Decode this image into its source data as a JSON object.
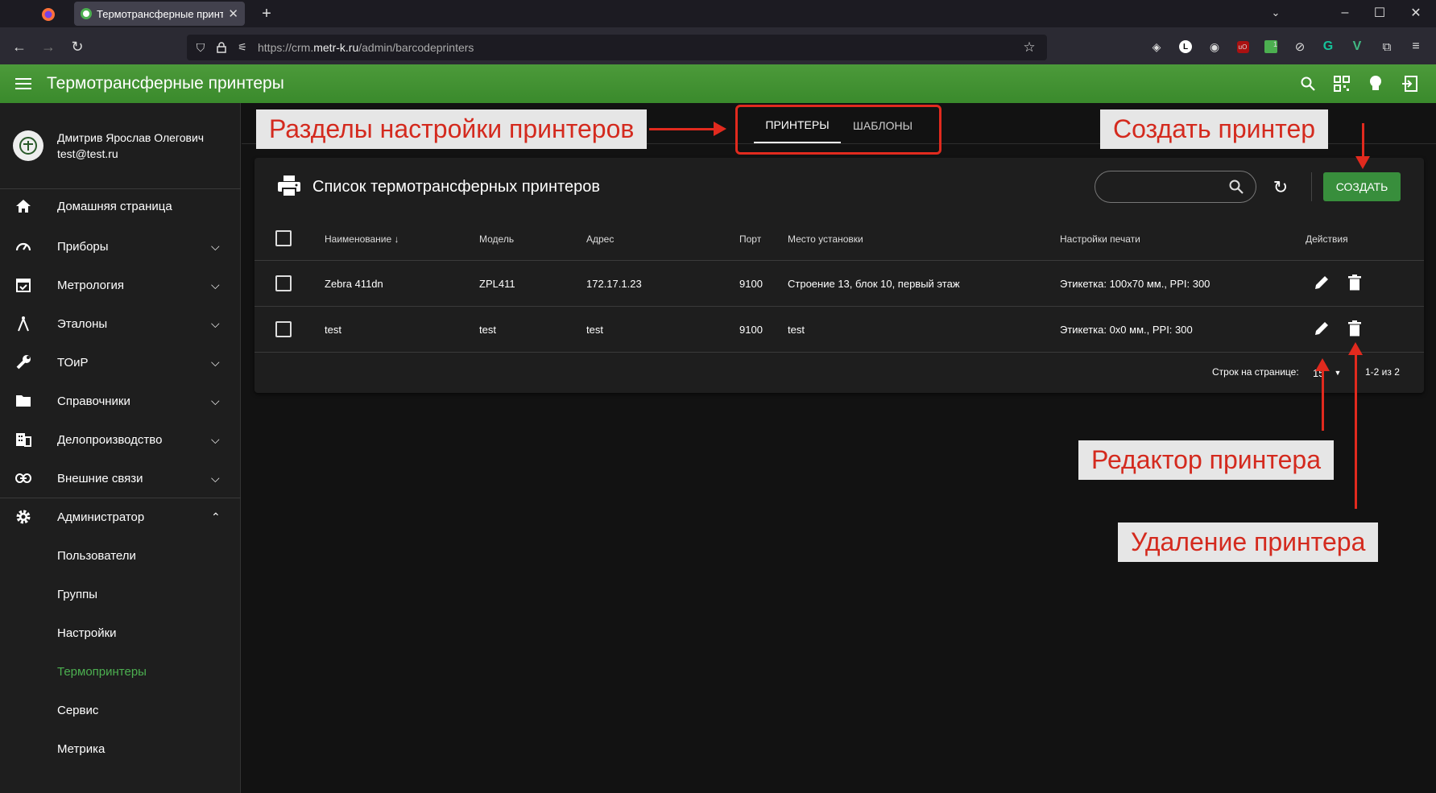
{
  "browser": {
    "tab_title": "Термотрансферные принтеры",
    "url_prefix": "https://crm.",
    "url_domain": "metr-k.ru",
    "url_path": "/admin/barcodeprinters"
  },
  "header": {
    "title": "Термотрансферные принтеры"
  },
  "user": {
    "name": "Дмитрив Ярослав Олегович",
    "email": "test@test.ru"
  },
  "sidebar": {
    "items": [
      {
        "label": "Домашняя страница",
        "icon": "home-icon"
      },
      {
        "label": "Приборы",
        "icon": "speedometer-icon"
      },
      {
        "label": "Метрология",
        "icon": "checkbox-calendar-icon"
      },
      {
        "label": "Эталоны",
        "icon": "compass-icon"
      },
      {
        "label": "ТОиР",
        "icon": "wrench-icon"
      },
      {
        "label": "Справочники",
        "icon": "folder-icon"
      },
      {
        "label": "Делопроизводство",
        "icon": "building-icon"
      },
      {
        "label": "Внешние связи",
        "icon": "link-icon"
      },
      {
        "label": "Администратор",
        "icon": "gear-icon"
      }
    ],
    "admin_sub": [
      {
        "label": "Пользователи"
      },
      {
        "label": "Группы"
      },
      {
        "label": "Настройки"
      },
      {
        "label": "Термопринтеры"
      },
      {
        "label": "Сервис"
      },
      {
        "label": "Метрика"
      }
    ]
  },
  "tabs": {
    "printers": "ПРИНТЕРЫ",
    "templates": "ШАБЛОНЫ"
  },
  "card": {
    "title": "Список термотрансферных принтеров",
    "create_label": "СОЗДАТЬ",
    "search_placeholder": ""
  },
  "table": {
    "headers": [
      "Наименование",
      "Модель",
      "Адрес",
      "Порт",
      "Место установки",
      "Настройки печати",
      "Действия"
    ],
    "rows": [
      [
        "Zebra 411dn",
        "ZPL411",
        "172.17.1.23",
        "9100",
        "Строение 13, блок 10, первый этаж",
        "Этикетка: 100х70 мм., PPI: 300"
      ],
      [
        "test",
        "test",
        "test",
        "9100",
        "test",
        "Этикетка: 0х0 мм., PPI: 300"
      ]
    ]
  },
  "pagination": {
    "rows_per_page_label": "Строк на странице:",
    "rows_per_page_value": "15",
    "range": "1-2 из 2"
  },
  "annotations": {
    "sections": "Разделы настройки принтеров",
    "create": "Создать принтер",
    "editor": "Редактор принтера",
    "delete": "Удаление принтера"
  },
  "colors": {
    "accent": "#3a8a2c",
    "active_nav": "#4caf50",
    "annotation": "#d42a1e"
  }
}
